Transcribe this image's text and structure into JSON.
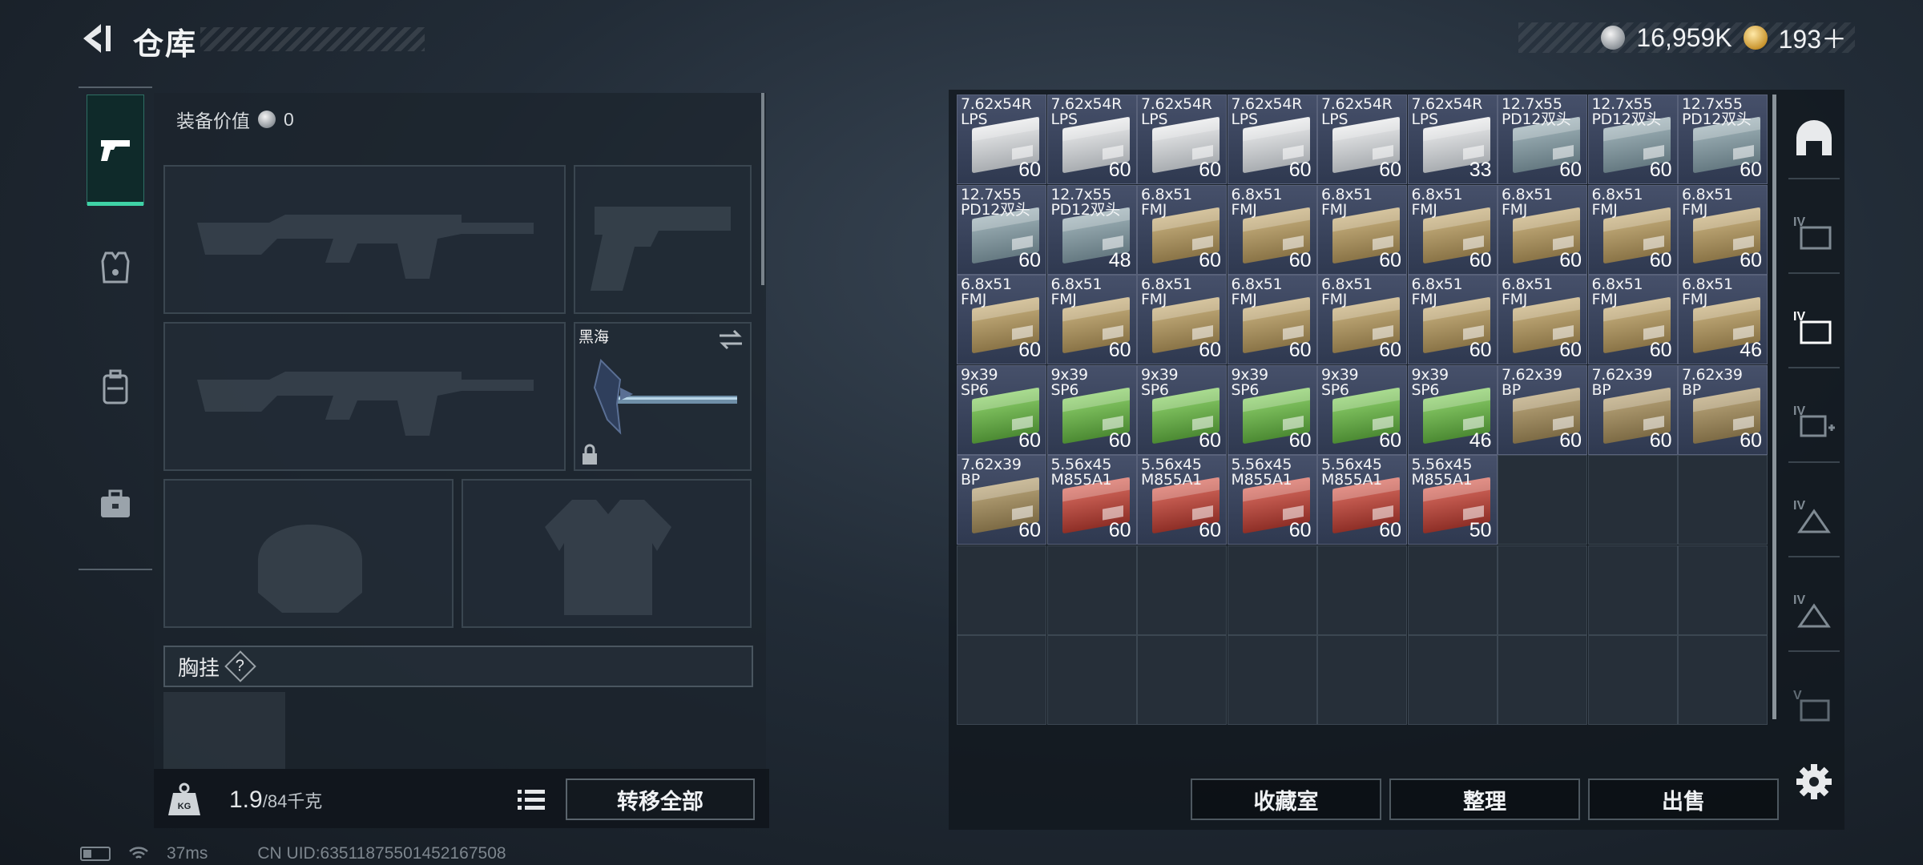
{
  "header": {
    "title": "仓库"
  },
  "currency": {
    "silver": "16,959K",
    "gold": "193＋"
  },
  "loadout": {
    "equip_value_label": "装备价值",
    "equip_value": "0",
    "melee_name": "黑海",
    "vest_label": "胸挂",
    "vest_help": "?",
    "weight_current": "1.9",
    "weight_max": "/84千克",
    "weight_icon_text": "KG",
    "transfer_all": "转移全部"
  },
  "stash": {
    "columns": 9,
    "rows": 7,
    "items": [
      {
        "name": "7.62x54R\nLPS",
        "count": "60",
        "color": "white"
      },
      {
        "name": "7.62x54R\nLPS",
        "count": "60",
        "color": "white"
      },
      {
        "name": "7.62x54R\nLPS",
        "count": "60",
        "color": "white"
      },
      {
        "name": "7.62x54R\nLPS",
        "count": "60",
        "color": "white"
      },
      {
        "name": "7.62x54R\nLPS",
        "count": "60",
        "color": "white"
      },
      {
        "name": "7.62x54R\nLPS",
        "count": "33",
        "color": "white"
      },
      {
        "name": "12.7x55\nPD12双头",
        "count": "60",
        "color": "steel"
      },
      {
        "name": "12.7x55\nPD12双头",
        "count": "60",
        "color": "steel"
      },
      {
        "name": "12.7x55\nPD12双头",
        "count": "60",
        "color": "steel"
      },
      {
        "name": "12.7x55\nPD12双头",
        "count": "60",
        "color": "steel"
      },
      {
        "name": "12.7x55\nPD12双头",
        "count": "48",
        "color": "steel"
      },
      {
        "name": "6.8x51\nFMJ",
        "count": "60",
        "color": "tan"
      },
      {
        "name": "6.8x51\nFMJ",
        "count": "60",
        "color": "tan"
      },
      {
        "name": "6.8x51\nFMJ",
        "count": "60",
        "color": "tan"
      },
      {
        "name": "6.8x51\nFMJ",
        "count": "60",
        "color": "tan"
      },
      {
        "name": "6.8x51\nFMJ",
        "count": "60",
        "color": "tan"
      },
      {
        "name": "6.8x51\nFMJ",
        "count": "60",
        "color": "tan"
      },
      {
        "name": "6.8x51\nFMJ",
        "count": "60",
        "color": "tan"
      },
      {
        "name": "6.8x51\nFMJ",
        "count": "60",
        "color": "tan"
      },
      {
        "name": "6.8x51\nFMJ",
        "count": "60",
        "color": "tan"
      },
      {
        "name": "6.8x51\nFMJ",
        "count": "60",
        "color": "tan"
      },
      {
        "name": "6.8x51\nFMJ",
        "count": "60",
        "color": "tan"
      },
      {
        "name": "6.8x51\nFMJ",
        "count": "60",
        "color": "tan"
      },
      {
        "name": "6.8x51\nFMJ",
        "count": "60",
        "color": "tan"
      },
      {
        "name": "6.8x51\nFMJ",
        "count": "60",
        "color": "tan"
      },
      {
        "name": "6.8x51\nFMJ",
        "count": "60",
        "color": "tan"
      },
      {
        "name": "6.8x51\nFMJ",
        "count": "46",
        "color": "tan"
      },
      {
        "name": "9x39\nSP6",
        "count": "60",
        "color": "green"
      },
      {
        "name": "9x39\nSP6",
        "count": "60",
        "color": "green"
      },
      {
        "name": "9x39\nSP6",
        "count": "60",
        "color": "green"
      },
      {
        "name": "9x39\nSP6",
        "count": "60",
        "color": "green"
      },
      {
        "name": "9x39\nSP6",
        "count": "60",
        "color": "green"
      },
      {
        "name": "9x39\nSP6",
        "count": "46",
        "color": "green"
      },
      {
        "name": "7.62x39\nBP",
        "count": "60",
        "color": "khaki"
      },
      {
        "name": "7.62x39\nBP",
        "count": "60",
        "color": "khaki"
      },
      {
        "name": "7.62x39\nBP",
        "count": "60",
        "color": "khaki"
      },
      {
        "name": "7.62x39\nBP",
        "count": "60",
        "color": "khaki"
      },
      {
        "name": "5.56x45\nM855A1",
        "count": "60",
        "color": "red"
      },
      {
        "name": "5.56x45\nM855A1",
        "count": "60",
        "color": "red"
      },
      {
        "name": "5.56x45\nM855A1",
        "count": "60",
        "color": "red"
      },
      {
        "name": "5.56x45\nM855A1",
        "count": "60",
        "color": "red"
      },
      {
        "name": "5.56x45\nM855A1",
        "count": "50",
        "color": "red"
      }
    ]
  },
  "right_rail": {
    "tabs": [
      "",
      "IV",
      "IV",
      "IV",
      "IV",
      "IV",
      "V"
    ]
  },
  "actions": {
    "collection": "收藏室",
    "sort": "整理",
    "sell": "出售"
  },
  "status": {
    "ping": "37ms",
    "uid": "CN UID:635118755014521675​08"
  }
}
